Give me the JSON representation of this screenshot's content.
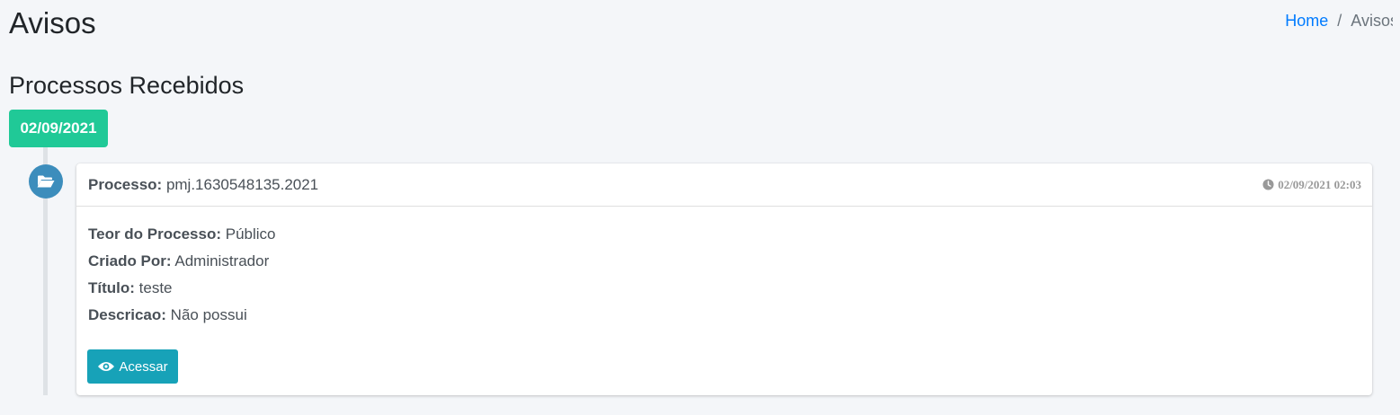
{
  "page": {
    "title": "Avisos",
    "section_title": "Processos Recebidos"
  },
  "breadcrumb": {
    "home": "Home",
    "separator": "/",
    "current": "Avisos"
  },
  "timeline": {
    "date_label": "02/09/2021",
    "date_color": "#20c997",
    "icon": "folder-open-icon",
    "icon_color": "#3c8dbc",
    "items": [
      {
        "header_label": "Processo:",
        "header_value": "pmj.1630548135.2021",
        "time": "02/09/2021 02:03",
        "fields": [
          {
            "label": "Teor do Processo:",
            "value": "Público"
          },
          {
            "label": "Criado Por:",
            "value": "Administrador"
          },
          {
            "label": "Título:",
            "value": "teste"
          },
          {
            "label": "Descricao:",
            "value": "Não possui"
          }
        ],
        "button_label": "Acessar",
        "button_color": "#17a2b8"
      }
    ]
  }
}
